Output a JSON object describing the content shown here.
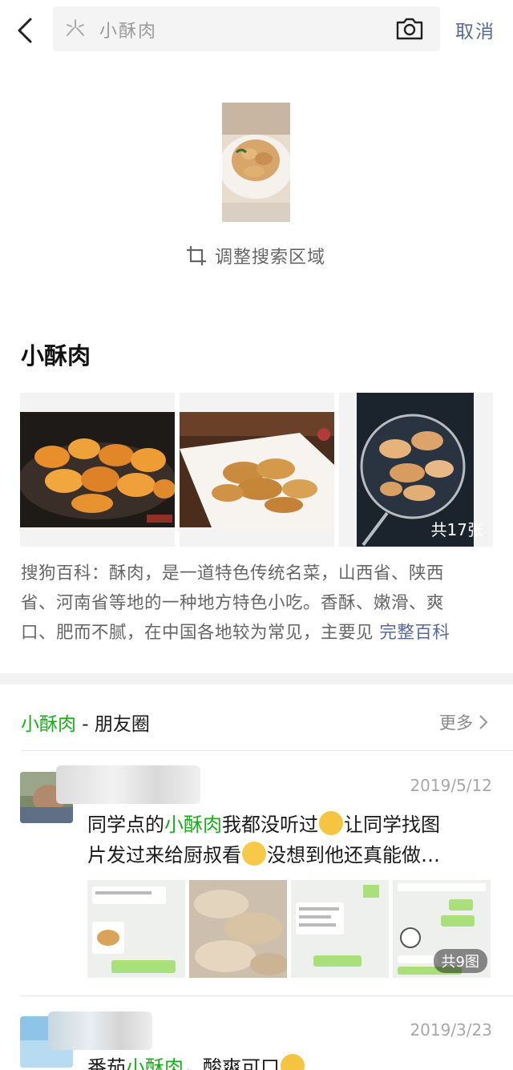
{
  "header": {
    "search_query": "小酥肉",
    "cancel_label": "取消"
  },
  "preview": {
    "adjust_label": "调整搜索区域"
  },
  "encyclopedia": {
    "title": "小酥肉",
    "image_count": "共17张",
    "desc_line1": "搜狗百科：酥肉，是一道特色传统名菜，山西省、陕西",
    "desc_line2": "省、河南省等地的一种地方特色小吃。香酥、嫩滑、爽",
    "desc_line3": "口、肥而不腻，在中国各地较为常见，主要见",
    "more_label": "完整百科"
  },
  "moments": {
    "keyword": "小酥肉",
    "section_suffix": " - 朋友圈",
    "more_label": "更多",
    "posts": [
      {
        "date": "2019/5/12",
        "text1_a": "同学点的",
        "text1_kw": "小酥肉",
        "text1_b": "我都没听过",
        "text1_c": "让同学找图",
        "text2_a": "片发过来给厨叔看",
        "text2_b": "没想到他还真能做…",
        "image_count": "共9图"
      },
      {
        "date": "2019/3/23",
        "text_a": "番茄",
        "text_kw": "小酥肉",
        "text_b": "，酸爽可口"
      }
    ]
  }
}
